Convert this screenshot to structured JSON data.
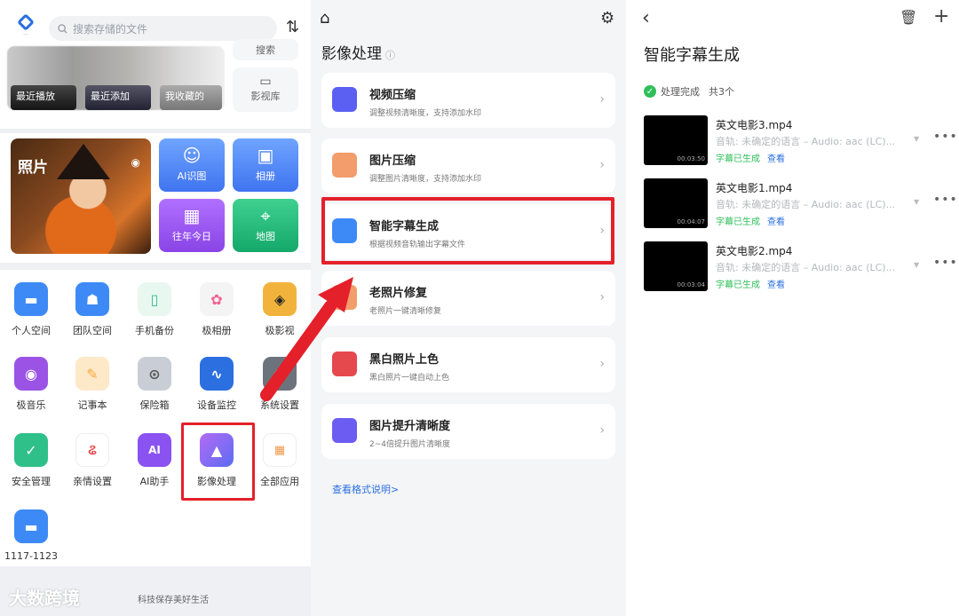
{
  "panel1": {
    "search": {
      "placeholder": "搜索存储的文件"
    },
    "media_cards": [
      "最近播放",
      "最近添加",
      "我收藏的"
    ],
    "side_buttons": [
      "搜索",
      "影视库"
    ],
    "photo_label": "照片",
    "tiles": [
      {
        "icon": "robot-icon",
        "label": "AI识图"
      },
      {
        "icon": "image-icon",
        "label": "相册"
      },
      {
        "icon": "calendar-icon",
        "label": "往年今日"
      },
      {
        "icon": "map-pin-icon",
        "label": "地图"
      }
    ],
    "apps": [
      {
        "label": "个人空间",
        "color": "#3d8af7"
      },
      {
        "label": "团队空间",
        "color": "#3d8af7"
      },
      {
        "label": "手机备份",
        "color": "#2fc089"
      },
      {
        "label": "极相册",
        "color": "#f2f2f2"
      },
      {
        "label": "极影视",
        "color": "#f2b33d"
      },
      {
        "label": "极音乐",
        "color": "#9b53e6"
      },
      {
        "label": "记事本",
        "color": "#f7a93a"
      },
      {
        "label": "保险箱",
        "color": "#c9ced6"
      },
      {
        "label": "设备监控",
        "color": "#2b6fe0"
      },
      {
        "label": "系统设置",
        "color": "#6d737c"
      },
      {
        "label": "安全管理",
        "color": "#2fc089"
      },
      {
        "label": "亲情设置",
        "color": "#ffffff"
      },
      {
        "label": "AI助手",
        "color": "#8a52f0"
      },
      {
        "label": "影像处理",
        "color": "#7b5cf5"
      },
      {
        "label": "全部应用",
        "color": "#ffffff"
      },
      {
        "label": "1117-1123",
        "color": "#3d8af7"
      }
    ],
    "watermark": "大数跨境",
    "slogan": "科技保存美好生活"
  },
  "panel2": {
    "title": "影像处理",
    "items": [
      {
        "title": "视频压缩",
        "desc": "调整视频清晰度，支持添加水印",
        "color": "#5b5ff2"
      },
      {
        "title": "图片压缩",
        "desc": "调整图片清晰度，支持添加水印",
        "color": "#f29d6b"
      },
      {
        "title": "智能字幕生成",
        "desc": "根据视频音轨输出字幕文件",
        "color": "#3d8af7"
      },
      {
        "title": "老照片修复",
        "desc": "老照片一键清晰修复",
        "color": "#f29d6b"
      },
      {
        "title": "黑白照片上色",
        "desc": "黑白照片一键自动上色",
        "color": "#e5484d"
      },
      {
        "title": "图片提升清晰度",
        "desc": "2~4倍提升图片清晰度",
        "color": "#6c5cf2"
      }
    ],
    "link": "查看格式说明>"
  },
  "panel3": {
    "title": "智能字幕生成",
    "status": "处理完成",
    "count": "共3个",
    "videos": [
      {
        "name": "英文电影3.mp4",
        "track": "音轨: 未确定的语言 – Audio: aac (LC)...",
        "duration": "00:03:50",
        "state": "字幕已生成",
        "view": "查看"
      },
      {
        "name": "英文电影1.mp4",
        "track": "音轨: 未确定的语言 – Audio: aac (LC)...",
        "duration": "00:04:07",
        "state": "字幕已生成",
        "view": "查看"
      },
      {
        "name": "英文电影2.mp4",
        "track": "音轨: 未确定的语言 – Audio: aac (LC)...",
        "duration": "00:03:04",
        "state": "字幕已生成",
        "view": "查看"
      }
    ]
  },
  "colors": {
    "accent": "#2b6fe0",
    "highlight": "#e4202a",
    "success": "#2fbf5a"
  }
}
